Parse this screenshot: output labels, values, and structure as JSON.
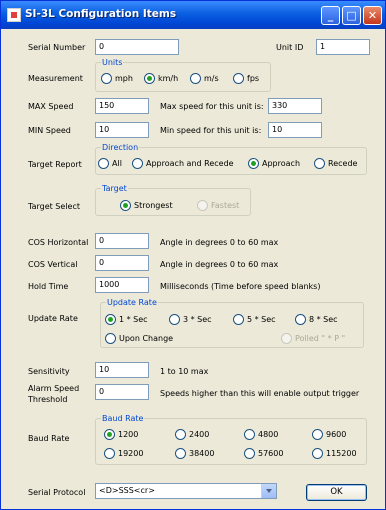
{
  "window": {
    "title": "SI-3L Configuration Items",
    "min_label": "_",
    "max_label": "□",
    "close_label": "✕"
  },
  "serial_number": {
    "label": "Serial Number",
    "value": "0"
  },
  "unit_id": {
    "label": "Unit ID",
    "value": "1"
  },
  "measurement": {
    "label": "Measurement",
    "group_label": "Units",
    "options": [
      "mph",
      "km/h",
      "m/s",
      "fps"
    ],
    "selected": "km/h"
  },
  "max_speed": {
    "label": "MAX Speed",
    "value": "150",
    "limit_label": "Max speed for this unit is:",
    "limit_value": "330"
  },
  "min_speed": {
    "label": "MIN Speed",
    "value": "10",
    "limit_label": "Min speed for this unit is:",
    "limit_value": "10"
  },
  "target_report": {
    "label": "Target Report",
    "group_label": "Direction",
    "options": [
      "All",
      "Approach and Recede",
      "Approach",
      "Recede"
    ],
    "selected": "Approach"
  },
  "target_select": {
    "label": "Target Select",
    "group_label": "Target",
    "options": [
      "Strongest",
      "Fastest"
    ],
    "selected": "Strongest"
  },
  "cos_horizontal": {
    "label": "COS Horizontal",
    "value": "0",
    "hint": "Angle in degrees 0 to 60 max"
  },
  "cos_vertical": {
    "label": "COS Vertical",
    "value": "0",
    "hint": "Angle in degrees 0 to 60 max"
  },
  "hold_time": {
    "label": "Hold Time",
    "value": "1000",
    "hint": "Milliseconds  (Time before speed blanks)"
  },
  "update_rate": {
    "label": "Update Rate",
    "group_label": "Update Rate",
    "options": [
      "1 * Sec",
      "3 * Sec",
      "5 * Sec",
      "8 * Sec",
      "Upon Change",
      "Polled \" * P \""
    ],
    "selected": "1 * Sec"
  },
  "sensitivity": {
    "label": "Sensitivity",
    "value": "10",
    "hint": "1 to 10 max"
  },
  "alarm_speed": {
    "label_line1": "Alarm Speed",
    "label_line2": "Threshold",
    "value": "0",
    "hint": "Speeds higher than this will enable output trigger"
  },
  "baud_rate": {
    "label": "Baud Rate",
    "group_label": "Baud Rate",
    "options": [
      "1200",
      "2400",
      "4800",
      "9600",
      "19200",
      "38400",
      "57600",
      "115200"
    ],
    "selected": "1200"
  },
  "serial_protocol": {
    "label": "Serial Protocol",
    "value": "<D>SSS<cr>"
  },
  "ok_label": "OK",
  "colors": {
    "title_bar": "#0a5fe0",
    "dialog_bg": "#ece9d8",
    "group_label": "#0046d5",
    "radio_dot": "#21a121"
  }
}
